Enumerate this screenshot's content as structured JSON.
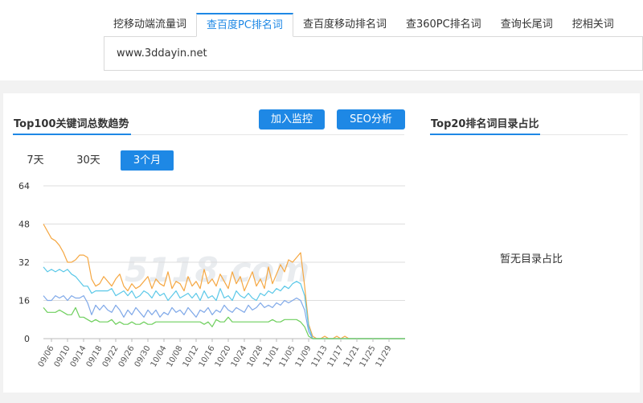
{
  "tabs": [
    {
      "label": "挖移动端流量词",
      "active": false
    },
    {
      "label": "查百度PC排名词",
      "active": true
    },
    {
      "label": "查百度移动排名词",
      "active": false
    },
    {
      "label": "查360PC排名词",
      "active": false
    },
    {
      "label": "查询长尾词",
      "active": false
    },
    {
      "label": "挖相关词",
      "active": false
    }
  ],
  "search": {
    "value": "www.3ddayin.net"
  },
  "trend": {
    "title": "Top100关键词总数趋势",
    "add_monitor_label": "加入监控",
    "seo_label": "SEO分析",
    "ranges": [
      "7天",
      "30天",
      "3个月"
    ],
    "active_range": "3个月"
  },
  "dir_panel": {
    "title": "Top20排名词目录占比",
    "empty_text": "暂无目录占比"
  },
  "watermark": "5118.com",
  "colors": {
    "accent": "#1e88e5",
    "orange": "#f5a742",
    "cyan": "#5bc8e8",
    "blue": "#7fa8e8",
    "green": "#6fcf5e"
  },
  "chart_data": {
    "type": "line",
    "ylim": [
      0,
      64
    ],
    "yticks": [
      0,
      16,
      32,
      48,
      64
    ],
    "x": [
      "09/04",
      "09/05",
      "09/06",
      "09/07",
      "09/08",
      "09/09",
      "09/10",
      "09/11",
      "09/12",
      "09/13",
      "09/14",
      "09/15",
      "09/16",
      "09/17",
      "09/18",
      "09/19",
      "09/20",
      "09/21",
      "09/22",
      "09/23",
      "09/24",
      "09/25",
      "09/26",
      "09/27",
      "09/28",
      "09/29",
      "09/30",
      "10/01",
      "10/02",
      "10/03",
      "10/04",
      "10/05",
      "10/06",
      "10/07",
      "10/08",
      "10/09",
      "10/10",
      "10/11",
      "10/12",
      "10/13",
      "10/14",
      "10/15",
      "10/16",
      "10/17",
      "10/18",
      "10/19",
      "10/20",
      "10/21",
      "10/22",
      "10/23",
      "10/24",
      "10/25",
      "10/26",
      "10/27",
      "10/28",
      "10/29",
      "10/30",
      "10/31",
      "11/01",
      "11/02",
      "11/03",
      "11/04",
      "11/05",
      "11/06",
      "11/07",
      "11/08",
      "11/09",
      "11/10",
      "11/11",
      "11/12",
      "11/13",
      "11/14",
      "11/15",
      "11/16",
      "11/17",
      "11/18",
      "11/19",
      "11/20",
      "11/21",
      "11/22",
      "11/23",
      "11/24",
      "11/25",
      "11/26",
      "11/27",
      "11/28",
      "11/29",
      "11/30",
      "12/01",
      "12/02",
      "12/03"
    ],
    "xtick_labels": [
      "09/06",
      "09/10",
      "09/14",
      "09/18",
      "09/22",
      "09/26",
      "09/30",
      "10/04",
      "10/08",
      "10/12",
      "10/16",
      "10/20",
      "10/24",
      "10/28",
      "11/01",
      "11/05",
      "11/09",
      "11/13",
      "11/17",
      "11/21",
      "11/25",
      "11/29"
    ],
    "series": [
      {
        "color": "#f5a742",
        "values": [
          48,
          45,
          42,
          41,
          39,
          36,
          32,
          32,
          33,
          35,
          35,
          34,
          25,
          22,
          23,
          26,
          24,
          22,
          25,
          27,
          22,
          20,
          23,
          21,
          22,
          24,
          26,
          21,
          25,
          23,
          22,
          28,
          21,
          24,
          23,
          20,
          26,
          22,
          24,
          21,
          29,
          23,
          25,
          22,
          27,
          24,
          21,
          28,
          23,
          26,
          20,
          24,
          28,
          22,
          25,
          21,
          30,
          23,
          27,
          31,
          28,
          33,
          32,
          34,
          36,
          22,
          6,
          1,
          0,
          0,
          1,
          0,
          0,
          1,
          0,
          1,
          0,
          0,
          0,
          0,
          0,
          0,
          0,
          0,
          0,
          0,
          0,
          0,
          0,
          0,
          0
        ]
      },
      {
        "color": "#5bc8e8",
        "values": [
          30,
          28,
          29,
          28,
          29,
          28,
          29,
          27,
          26,
          24,
          22,
          22,
          19,
          20,
          20,
          20,
          20,
          21,
          18,
          19,
          20,
          18,
          20,
          17,
          18,
          20,
          19,
          17,
          20,
          18,
          19,
          16,
          18,
          20,
          17,
          18,
          19,
          17,
          19,
          16,
          20,
          17,
          18,
          16,
          21,
          17,
          18,
          16,
          20,
          18,
          17,
          19,
          17,
          16,
          19,
          18,
          20,
          19,
          21,
          20,
          22,
          21,
          23,
          24,
          23,
          18,
          5,
          0,
          0,
          0,
          0,
          0,
          0,
          0,
          0,
          0,
          0,
          0,
          0,
          0,
          0,
          0,
          0,
          0,
          0,
          0,
          0,
          0,
          0,
          0,
          0
        ]
      },
      {
        "color": "#7fa8e8",
        "values": [
          18,
          16,
          16,
          18,
          17,
          18,
          16,
          18,
          17,
          17,
          18,
          15,
          10,
          14,
          12,
          14,
          12,
          11,
          14,
          12,
          9,
          12,
          10,
          13,
          11,
          9,
          12,
          10,
          12,
          9,
          11,
          10,
          13,
          11,
          12,
          10,
          13,
          11,
          9,
          12,
          11,
          13,
          10,
          12,
          11,
          14,
          12,
          11,
          13,
          12,
          11,
          14,
          12,
          13,
          15,
          13,
          14,
          13,
          15,
          14,
          16,
          15,
          16,
          17,
          16,
          12,
          3,
          0,
          0,
          0,
          0,
          0,
          0,
          0,
          0,
          0,
          0,
          0,
          0,
          0,
          0,
          0,
          0,
          0,
          0,
          0,
          0,
          0,
          0,
          0,
          0
        ]
      },
      {
        "color": "#6fcf5e",
        "values": [
          13,
          11,
          11,
          11,
          12,
          11,
          10,
          10,
          13,
          9,
          9,
          8,
          7,
          8,
          7,
          7,
          7,
          8,
          6,
          7,
          6,
          6,
          7,
          6,
          6,
          7,
          6,
          6,
          7,
          7,
          7,
          7,
          7,
          7,
          7,
          7,
          7,
          7,
          7,
          7,
          6,
          7,
          5,
          8,
          7,
          7,
          9,
          7,
          7,
          7,
          7,
          7,
          7,
          7,
          7,
          7,
          7,
          8,
          7,
          7,
          8,
          8,
          8,
          8,
          7,
          5,
          1,
          0,
          0,
          0,
          0,
          0,
          0,
          0,
          0,
          0,
          0,
          0,
          0,
          0,
          0,
          0,
          0,
          0,
          0,
          0,
          0,
          0,
          0,
          0,
          0
        ]
      }
    ]
  }
}
